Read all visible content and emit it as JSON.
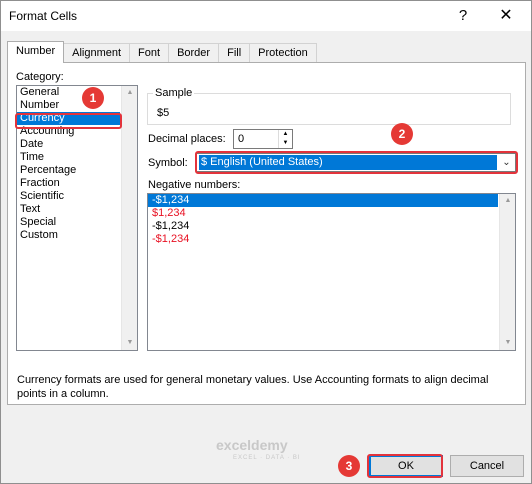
{
  "window": {
    "title": "Format Cells",
    "help_label": "?",
    "close_label": "✕"
  },
  "tabs": [
    {
      "label": "Number"
    },
    {
      "label": "Alignment"
    },
    {
      "label": "Font"
    },
    {
      "label": "Border"
    },
    {
      "label": "Fill"
    },
    {
      "label": "Protection"
    }
  ],
  "category": {
    "label": "Category:",
    "items": [
      "General",
      "Number",
      "Currency",
      "Accounting",
      "Date",
      "Time",
      "Percentage",
      "Fraction",
      "Scientific",
      "Text",
      "Special",
      "Custom"
    ],
    "selected": "Currency"
  },
  "sample": {
    "label": "Sample",
    "value": "$5"
  },
  "decimal_places": {
    "label": "Decimal places:",
    "value": "0"
  },
  "symbol": {
    "label": "Symbol:",
    "value": "$ English (United States)"
  },
  "negative_numbers": {
    "label": "Negative numbers:",
    "items": [
      {
        "text": "-$1,234",
        "color": "#ffffff",
        "selected": true
      },
      {
        "text": "$1,234",
        "color": "#e81123",
        "selected": false
      },
      {
        "text": "-$1,234",
        "color": "#000000",
        "selected": false
      },
      {
        "text": "-$1,234",
        "color": "#e81123",
        "selected": false
      }
    ]
  },
  "description": "Currency formats are used for general monetary values.  Use Accounting formats to align decimal points in a column.",
  "buttons": {
    "ok": "OK",
    "cancel": "Cancel"
  },
  "annotations": {
    "badge1": "1",
    "badge2": "2",
    "badge3": "3",
    "accent_color": "#e3333b"
  },
  "watermark": {
    "name": "exceldemy",
    "tagline": "EXCEL · DATA · BI"
  }
}
